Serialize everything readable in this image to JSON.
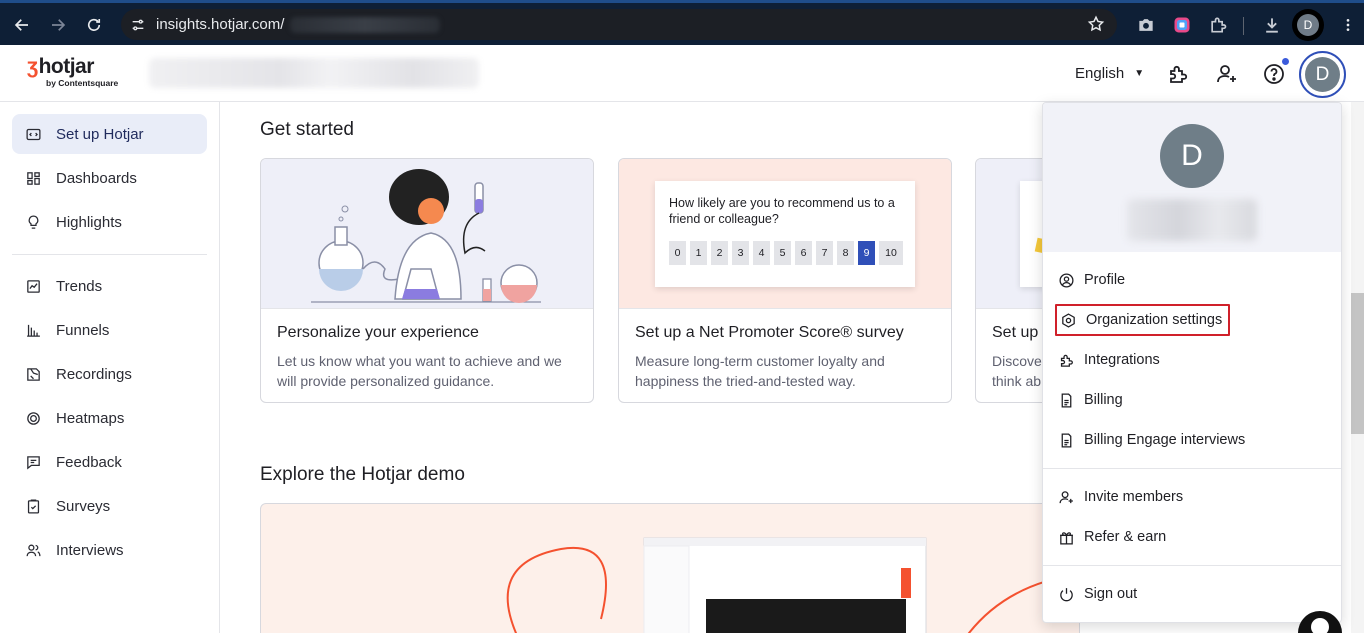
{
  "browser": {
    "url": "insights.hotjar.com/"
  },
  "header": {
    "logo_text": "hotjar",
    "logo_sub": "by Contentsquare",
    "language": "English",
    "avatar_initial": "D",
    "browser_profile_initial": "D"
  },
  "sidebar": {
    "items": [
      {
        "label": "Set up Hotjar",
        "icon": "setup-icon"
      },
      {
        "label": "Dashboards",
        "icon": "dashboards-icon"
      },
      {
        "label": "Highlights",
        "icon": "lightbulb-icon"
      },
      {
        "label": "Trends",
        "icon": "trends-icon"
      },
      {
        "label": "Funnels",
        "icon": "funnels-icon"
      },
      {
        "label": "Recordings",
        "icon": "recordings-icon"
      },
      {
        "label": "Heatmaps",
        "icon": "heatmaps-icon"
      },
      {
        "label": "Feedback",
        "icon": "feedback-icon"
      },
      {
        "label": "Surveys",
        "icon": "surveys-icon"
      },
      {
        "label": "Interviews",
        "icon": "interviews-icon"
      }
    ]
  },
  "main": {
    "get_started_title": "Get started",
    "cards": [
      {
        "title": "Personalize your experience",
        "description": "Let us know what you want to achieve and we will provide personalized guidance."
      },
      {
        "title": "Set up a Net Promoter Score® survey",
        "description": "Measure long-term customer loyalty and happiness the tried-and-tested way."
      },
      {
        "title": "Set up",
        "description": "Discove think ab"
      }
    ],
    "nps": {
      "question": "How likely are you to recommend us to a friend or colleague?",
      "scale": [
        "0",
        "1",
        "2",
        "3",
        "4",
        "5",
        "6",
        "7",
        "8",
        "9",
        "10"
      ],
      "selected": "9"
    },
    "demo_title": "Explore the Hotjar demo"
  },
  "menu": {
    "avatar_initial": "D",
    "items": [
      {
        "label": "Profile",
        "icon": "profile-icon"
      },
      {
        "label": "Organization settings",
        "icon": "settings-hex-icon"
      },
      {
        "label": "Integrations",
        "icon": "puzzle-icon"
      },
      {
        "label": "Billing",
        "icon": "billing-icon"
      },
      {
        "label": "Billing Engage interviews",
        "icon": "billing-icon"
      },
      {
        "label": "Invite members",
        "icon": "invite-icon"
      },
      {
        "label": "Refer & earn",
        "icon": "gift-icon"
      },
      {
        "label": "Sign out",
        "icon": "power-icon"
      }
    ]
  },
  "colors": {
    "accent": "#2f4fb8",
    "brand": "#f4512f",
    "highlight_border": "#d0202a",
    "active_nav_bg": "#e9edf8"
  }
}
